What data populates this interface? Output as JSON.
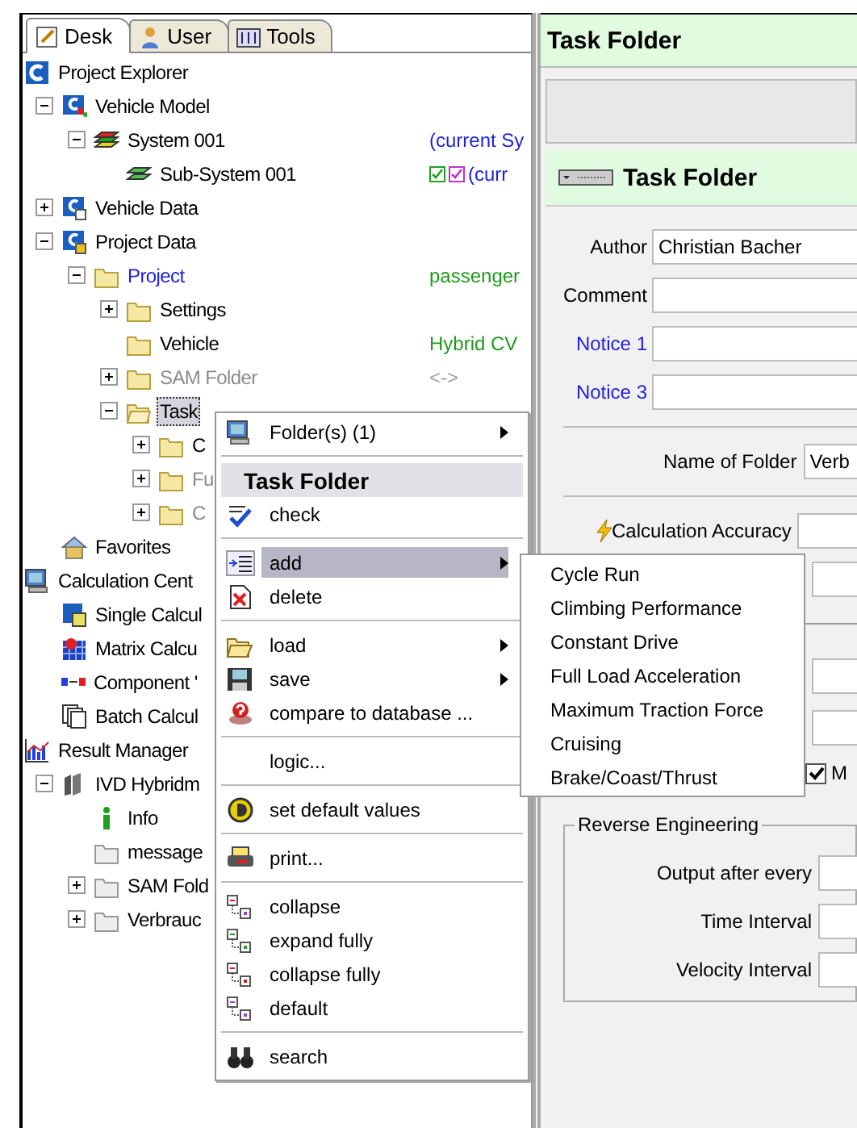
{
  "tabs": [
    {
      "label": "Desk",
      "selected": true
    },
    {
      "label": "User",
      "selected": false
    },
    {
      "label": "Tools",
      "selected": false
    }
  ],
  "tree": [
    {
      "label": "Project Explorer",
      "kind": "explorer",
      "selected": false,
      "disabled": false,
      "linked": false,
      "children": [
        {
          "label": "Vehicle Model",
          "kind": "model",
          "expanded": true,
          "selected": false,
          "disabled": false,
          "linked": false,
          "children": [
            {
              "label": "System 001",
              "kind": "system",
              "expanded": true,
              "selected": false,
              "disabled": false,
              "linked": false,
              "value": {
                "text": "(current Sy",
                "color": "#1f1fe0"
              },
              "children": [
                {
                  "label": "Sub-System 001",
                  "kind": "subsystem",
                  "selected": false,
                  "disabled": false,
                  "linked": false,
                  "flags": [
                    {
                      "checked": true,
                      "color": "#20a020"
                    },
                    {
                      "checked": true,
                      "color": "#c030d0"
                    }
                  ],
                  "value": {
                    "text": "(curr",
                    "color": "#1f1fe0"
                  }
                }
              ]
            }
          ]
        },
        {
          "label": "Vehicle Data",
          "kind": "data",
          "expanded": false,
          "selected": false,
          "disabled": false,
          "linked": false
        },
        {
          "label": "Project Data",
          "kind": "projectdata",
          "expanded": true,
          "selected": false,
          "disabled": false,
          "linked": false,
          "children": [
            {
              "label": "Project",
              "kind": "folder",
              "expanded": true,
              "selected": false,
              "disabled": false,
              "linked": true,
              "value": {
                "text": "passenger",
                "color": "#1e9a1e"
              },
              "children": [
                {
                  "label": "Settings",
                  "kind": "folder",
                  "expanded": false,
                  "selected": false,
                  "disabled": false,
                  "linked": false
                },
                {
                  "label": "Vehicle",
                  "kind": "folder",
                  "selected": false,
                  "disabled": false,
                  "linked": false,
                  "value": {
                    "text": "Hybrid CV",
                    "color": "#1e9a1e"
                  }
                },
                {
                  "label": "SAM Folder",
                  "kind": "folder",
                  "expanded": false,
                  "selected": false,
                  "disabled": true,
                  "linked": false,
                  "value": {
                    "text": "<->",
                    "color": "#a0a0a0"
                  }
                },
                {
                  "label": "Task",
                  "kind": "openfolder",
                  "expanded": true,
                  "selected": true,
                  "disabled": false,
                  "linked": false,
                  "children": [
                    {
                      "label": "C",
                      "kind": "folder",
                      "expanded": false,
                      "selected": false,
                      "disabled": false,
                      "linked": false
                    },
                    {
                      "label": "Fu",
                      "kind": "folder",
                      "expanded": false,
                      "selected": false,
                      "disabled": true,
                      "linked": false
                    },
                    {
                      "label": "C",
                      "kind": "folder",
                      "expanded": false,
                      "selected": false,
                      "disabled": true,
                      "linked": false
                    }
                  ]
                }
              ]
            }
          ]
        },
        {
          "label": "Favorites",
          "kind": "favorites",
          "selected": false,
          "disabled": false,
          "linked": false
        }
      ]
    },
    {
      "label": "Calculation Cent",
      "kind": "computer",
      "selected": false,
      "disabled": false,
      "linked": false,
      "children": [
        {
          "label": "Single Calcul",
          "kind": "single",
          "selected": false,
          "disabled": false,
          "linked": false
        },
        {
          "label": "Matrix Calcu",
          "kind": "matrix",
          "selected": false,
          "disabled": false,
          "linked": false
        },
        {
          "label": "Component '",
          "kind": "component",
          "selected": false,
          "disabled": false,
          "linked": false
        },
        {
          "label": "Batch Calcul",
          "kind": "batch",
          "selected": false,
          "disabled": false,
          "linked": false
        }
      ]
    },
    {
      "label": "Result Manager",
      "kind": "result",
      "selected": false,
      "disabled": false,
      "linked": false,
      "children": [
        {
          "label": "IVD Hybridm",
          "kind": "ivd",
          "expanded": true,
          "selected": false,
          "disabled": false,
          "linked": false,
          "children": [
            {
              "label": "Info",
              "kind": "info",
              "selected": false,
              "disabled": false,
              "linked": false
            },
            {
              "label": "message",
              "kind": "greyfolder",
              "selected": false,
              "disabled": false,
              "linked": false
            },
            {
              "label": "SAM Fold",
              "kind": "greyfolder",
              "expanded": false,
              "selected": false,
              "disabled": false,
              "linked": false
            },
            {
              "label": "Verbrauc",
              "kind": "greyfolder",
              "expanded": false,
              "selected": false,
              "disabled": false,
              "linked": false
            }
          ]
        }
      ]
    }
  ],
  "context_menu": {
    "items": [
      {
        "kind": "item",
        "label": "Folder(s) (1)",
        "submenu": true,
        "selected": false
      },
      {
        "kind": "separator"
      },
      {
        "kind": "header",
        "label": "Task Folder"
      },
      {
        "kind": "item",
        "label": "check",
        "submenu": false,
        "selected": false
      },
      {
        "kind": "separator"
      },
      {
        "kind": "item",
        "label": "add",
        "submenu": true,
        "selected": true
      },
      {
        "kind": "item",
        "label": "delete",
        "submenu": false,
        "selected": false
      },
      {
        "kind": "separator"
      },
      {
        "kind": "item",
        "label": "load",
        "submenu": true,
        "selected": false
      },
      {
        "kind": "item",
        "label": "save",
        "submenu": true,
        "selected": false
      },
      {
        "kind": "item",
        "label": "compare to database ...",
        "submenu": false,
        "selected": false
      },
      {
        "kind": "separator"
      },
      {
        "kind": "item",
        "label": "logic...",
        "submenu": false,
        "selected": false
      },
      {
        "kind": "separator"
      },
      {
        "kind": "item",
        "label": "set default values",
        "submenu": false,
        "selected": false
      },
      {
        "kind": "separator"
      },
      {
        "kind": "item",
        "label": "print...",
        "submenu": false,
        "selected": false
      },
      {
        "kind": "separator"
      },
      {
        "kind": "item",
        "label": "collapse",
        "submenu": false,
        "selected": false
      },
      {
        "kind": "item",
        "label": "expand fully",
        "submenu": false,
        "selected": false
      },
      {
        "kind": "item",
        "label": "collapse fully",
        "submenu": false,
        "selected": false
      },
      {
        "kind": "item",
        "label": "default",
        "submenu": false,
        "selected": false
      },
      {
        "kind": "separator"
      },
      {
        "kind": "item",
        "label": "search",
        "submenu": false,
        "selected": false
      }
    ]
  },
  "submenu": {
    "items": [
      "Cycle Run",
      "Climbing Performance",
      "Constant Drive",
      "Full Load Acceleration",
      "Maximum Traction Force",
      "Cruising",
      "Brake/Coast/Thrust"
    ]
  },
  "details": {
    "title": "Task Folder",
    "section_title": "Task Folder",
    "fields": [
      {
        "label": "Author",
        "value": "Christian Bacher",
        "linked": false
      },
      {
        "label": "Comment",
        "linked": false
      },
      {
        "label": "Notice 1",
        "linked": true
      },
      {
        "label": "Notice 3",
        "linked": true
      }
    ],
    "folder_name": {
      "label": "Name of Folder",
      "value": "Verb"
    },
    "accuracy": {
      "label": "Calculation Accuracy"
    },
    "option": {
      "label": "M",
      "checked": true
    },
    "group": {
      "title": "Reverse Engineering",
      "fields": [
        "Output after every",
        "Time Interval",
        "Velocity Interval"
      ]
    }
  }
}
